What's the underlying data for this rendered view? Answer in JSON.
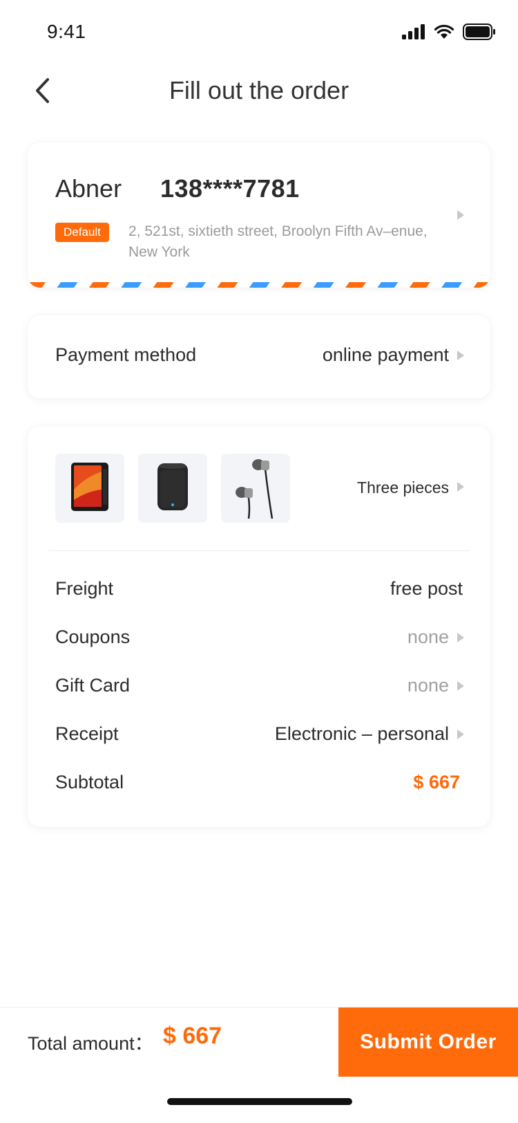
{
  "status_bar": {
    "time": "9:41"
  },
  "nav": {
    "title": "Fill out the order"
  },
  "address": {
    "name": "Abner",
    "phone": "138****7781",
    "badge": "Default",
    "text": "2, 521st, sixtieth street, Broolyn Fifth Av–enue, New York"
  },
  "payment": {
    "label": "Payment method",
    "value": "online payment"
  },
  "items": {
    "products": [
      "phone",
      "speaker",
      "earphones"
    ],
    "summary": "Three pieces"
  },
  "order_rows": {
    "freight": {
      "label": "Freight",
      "value": "free post"
    },
    "coupons": {
      "label": "Coupons",
      "value": "none"
    },
    "gift_card": {
      "label": "Gift Card",
      "value": "none"
    },
    "receipt": {
      "label": "Receipt",
      "value": "Electronic – personal"
    },
    "subtotal": {
      "label": "Subtotal",
      "value": "$ 667"
    }
  },
  "footer": {
    "total_label": "Total amount：",
    "total_value": "$ 667",
    "submit_label": "Submit Order"
  },
  "colors": {
    "accent": "#ff6a0a",
    "stripe_blue": "#3a9cff",
    "muted": "#a0a0a0",
    "text": "#2b2b2b"
  },
  "icons": [
    "cellular-signal-icon",
    "wifi-icon",
    "battery-icon",
    "back-chevron-icon",
    "arrow-right-icon"
  ]
}
